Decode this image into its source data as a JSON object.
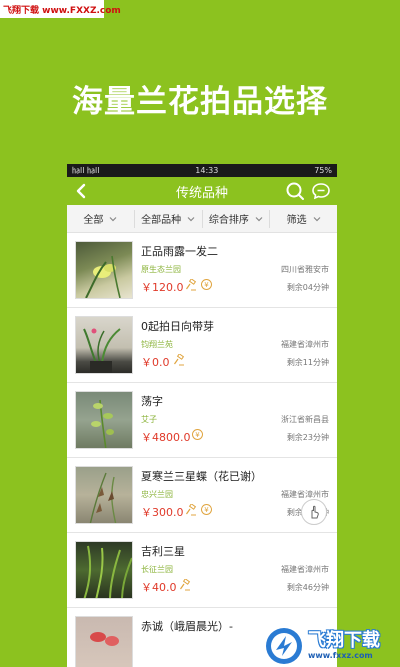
{
  "watermark_top": "飞翔下载 www.FXXZ.com",
  "headline": "海量兰花拍品选择",
  "status_bar": {
    "signal": "㏊ll ㏊ll",
    "time": "14:33",
    "battery": "75%"
  },
  "title_bar": {
    "title": "传统品种"
  },
  "filters": [
    {
      "label": "全部"
    },
    {
      "label": "全部品种"
    },
    {
      "label": "综合排序"
    },
    {
      "label": "筛选"
    }
  ],
  "items": [
    {
      "name": "正品雨露一发二",
      "shop": "原生态兰园",
      "price": "￥120.0",
      "location": "四川省雅安市",
      "remaining": "剩余04分钟",
      "badges": [
        "hammer",
        "coin"
      ]
    },
    {
      "name": "0起拍日向带芽",
      "shop": "钧翔兰苑",
      "price": "￥0.0",
      "location": "福建省漳州市",
      "remaining": "剩余11分钟",
      "badges": [
        "hammer"
      ]
    },
    {
      "name": "荡字",
      "shop": "艾子",
      "price": "￥4800.0",
      "location": "浙江省新昌县",
      "remaining": "剩余23分钟",
      "badges": [
        "coin"
      ]
    },
    {
      "name": "夏寒兰三星蝶（花已谢）",
      "shop": "忠兴兰园",
      "price": "￥300.0",
      "location": "福建省漳州市",
      "remaining": "剩余34分钟",
      "badges": [
        "hammer",
        "coin"
      ]
    },
    {
      "name": "吉利三星",
      "shop": "长征兰园",
      "price": "￥40.0",
      "location": "福建省漳州市",
      "remaining": "剩余46分钟",
      "badges": [
        "hammer"
      ]
    },
    {
      "name": "赤诚（峨眉晨光）-",
      "shop": "",
      "price": "",
      "location": "",
      "remaining": "",
      "badges": []
    }
  ],
  "watermark_bottom": {
    "big": "飞翔下载",
    "small": "www.fxxz.com"
  },
  "colors": {
    "brand_green": "#8cc21f",
    "price_red": "#e03a2a",
    "shop_green": "#8cb43c"
  }
}
